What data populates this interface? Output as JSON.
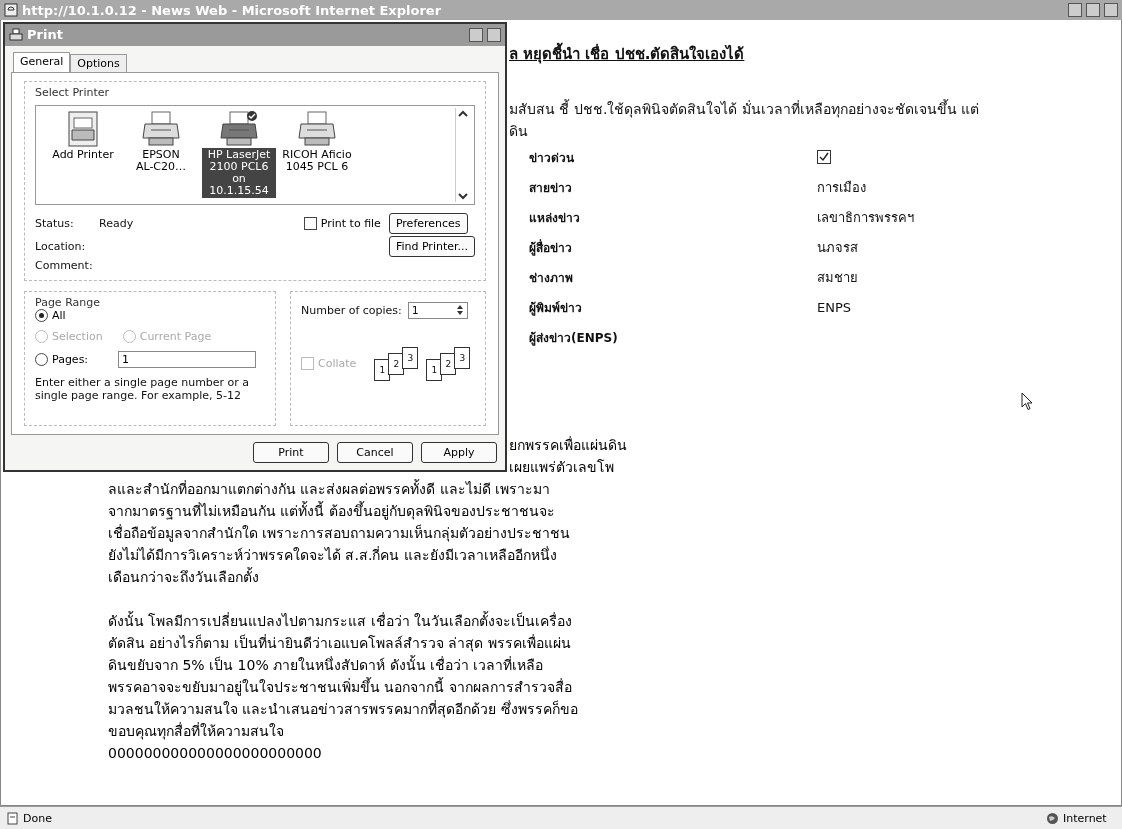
{
  "window": {
    "title": "http://10.1.0.12 - News Web - Microsoft Internet Explorer"
  },
  "article": {
    "headline": "ล หยุดชี้นำ เชื่อ ปชช.ตัดสินใจเองได้",
    "intro": "มสับสน ชี้ ปชช.ใช้ดุลพินิจตัดสินใจได้ มั่นเวลาที่เหลือทุกอย่างจะชัดเจนขึ้น แต่\nดิน",
    "fields": [
      {
        "label": "ข่าวด่วน",
        "kind": "checkbox",
        "checked": true
      },
      {
        "label": "สายข่าว",
        "kind": "text",
        "value": "การเมือง"
      },
      {
        "label": "แหล่งข่าว",
        "kind": "text",
        "value": "เลขาธิการพรรคฯ"
      },
      {
        "label": "ผู้สื่อข่าว",
        "kind": "text",
        "value": "นภจรส"
      },
      {
        "label": "ช่างภาพ",
        "kind": "text",
        "value": "สมชาย"
      },
      {
        "label": "ผู้พิมพ์ข่าว",
        "kind": "text",
        "value": "ENPS"
      },
      {
        "label": "ผู้ส่งข่าว(ENPS)",
        "kind": "text"
      }
    ],
    "partial_lines": [
      "ยกพรรคเพื่อแผ่นดิน",
      "เผยแพร่ตัวเลขโพ"
    ],
    "paragraphs": [
      "ลและสำนักที่ออกมาแตกต่างกัน และส่งผลต่อพรรคทั้งดี และไม่ดี เพราะมา\nจากมาตรฐานที่ไม่เหมือนกัน แต่ทั้งนี้ ต้องขึ้นอยู่กับดุลพินิจของประชาชนจะ\nเชื่อถือข้อมูลจากสำนักใด เพราะการสอบถามความเห็นกลุ่มตัวอย่างประชาชน\nยังไม่ได้มีการวิเคราะห์ว่าพรรคใดจะได้ ส.ส.กี่คน และยังมีเวลาเหลืออีกหนึ่ง\nเดือนกว่าจะถึงวันเลือกตั้ง",
      "ดังนั้น โพลมีการเปลี่ยนแปลงไปตามกระแส เชื่อว่า ในวันเลือกตั้งจะเป็นเครื่อง\nตัดสิน อย่างไรก็ตาม เป็นที่น่ายินดีว่าเอแบคโพลล์สำรวจ ล่าสุด พรรคเพื่อแผ่น\nดินขยับจาก 5% เป็น 10% ภายในหนึ่งสัปดาห์ ดังนั้น เชื่อว่า เวลาที่เหลือ\nพรรคอาจจะขยับมาอยู่ในใจประชาชนเพิ่มขึ้น นอกจากนี้ จากผลการสำรวจสื่อ\nมวลชนให้ความสนใจ และนำเสนอข่าวสารพรรคมากที่สุดอีกด้วย ซึ่งพรรคก็ขอ\nขอบคุณทุกสื่อที่ให้ความสนใจ"
    ],
    "trailer": "000000000000000000000000"
  },
  "dialog": {
    "title": "Print",
    "tabs": [
      {
        "label": "General",
        "selected": true
      },
      {
        "label": "Options",
        "selected": false
      }
    ],
    "printer_group": "Select Printer",
    "printers": [
      {
        "name": "Add Printer",
        "kind": "add",
        "selected": false
      },
      {
        "name": "EPSON\nAL-C20…",
        "kind": "printer",
        "default": false,
        "selected": false
      },
      {
        "name": "HP LaserJet\n2100 PCL6 on\n10.1.15.54",
        "kind": "printer",
        "default": true,
        "selected": true
      },
      {
        "name": "RICOH Aficio\n1045 PCL 6",
        "kind": "printer",
        "default": false,
        "selected": false
      }
    ],
    "info": [
      {
        "label": "Status:",
        "value": "Ready"
      },
      {
        "label": "Location:"
      },
      {
        "label": "Comment:"
      }
    ],
    "print_to_file": {
      "label": "Print to file",
      "checked": false
    },
    "preferences_button": "Preferences",
    "find_printer_button": "Find Printer...",
    "page_range": {
      "title": "Page Range",
      "options": [
        {
          "label": "All",
          "kind": "all",
          "selected": true,
          "disabled": false
        },
        {
          "label": "Selection",
          "kind": "selection",
          "selected": false,
          "disabled": true
        },
        {
          "label": "Current Page",
          "kind": "current",
          "selected": false,
          "disabled": true
        },
        {
          "label": "Pages:",
          "kind": "pages",
          "selected": false,
          "disabled": false,
          "value": "1"
        }
      ],
      "hint": "Enter either a single page number or a single page range.  For example, 5-12"
    },
    "copies": {
      "label": "Number of copies:",
      "value": "1",
      "collate": {
        "label": "Collate",
        "checked": false,
        "disabled": true
      },
      "collate_sets": [
        [
          "1",
          "2",
          "3"
        ],
        [
          "1",
          "2",
          "3"
        ]
      ]
    },
    "buttons": [
      "Print",
      "Cancel",
      "Apply"
    ]
  },
  "status_bar": {
    "text": "Done",
    "zone": "Internet"
  }
}
